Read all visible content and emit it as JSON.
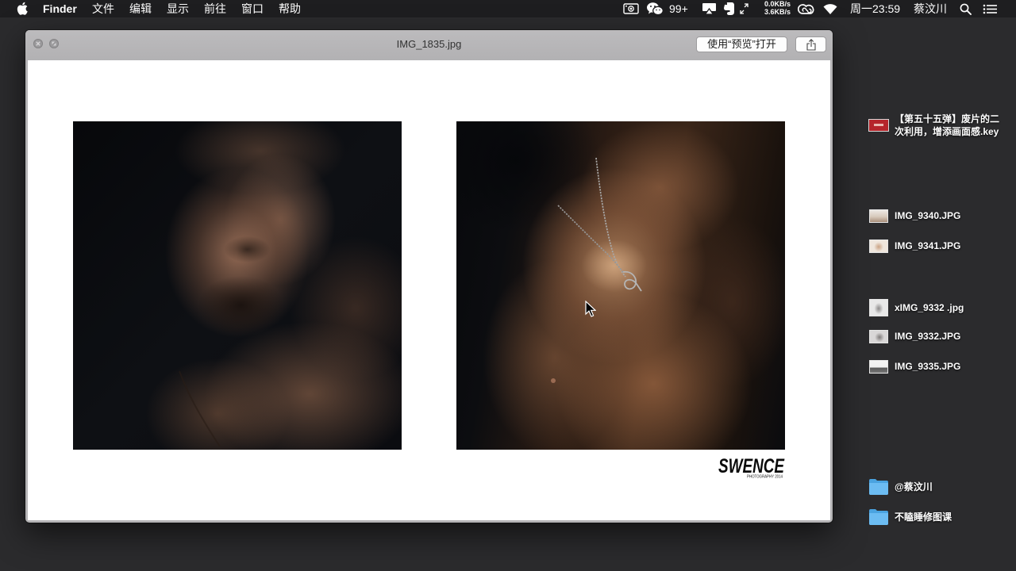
{
  "menubar": {
    "app_name": "Finder",
    "menus": [
      "文件",
      "编辑",
      "显示",
      "前往",
      "窗口",
      "帮助"
    ],
    "status": {
      "wechat_badge": "99+",
      "net_upload": "0.0KB/s",
      "net_download": "3.6KB/s",
      "clock": "周一23:59",
      "user": "蔡汶川"
    },
    "icons": [
      "apple-icon",
      "screen-record-icon",
      "wechat-icon",
      "airplay-icon",
      "evernote-icon",
      "expand-icon",
      "creative-cloud-icon",
      "wifi-icon",
      "search-icon",
      "list-icon"
    ]
  },
  "quicklook": {
    "title": "IMG_1835.jpg",
    "open_with_label": "使用“预览”打开",
    "icons": [
      "close-icon",
      "fullscreen-icon",
      "share-icon"
    ],
    "logo": {
      "text": "SWENCE",
      "subtitle": "PHOTOGRAPHY 2014"
    }
  },
  "desktop": {
    "items": [
      {
        "icon": "keynote-file-icon",
        "lines": [
          "【第五十五弹】废片的二",
          "次利用，增添画面感.key"
        ]
      },
      {
        "icon": "image-file-icon",
        "lines": [
          "IMG_9340.JPG"
        ]
      },
      {
        "icon": "image-file-icon",
        "lines": [
          "IMG_9341.JPG"
        ]
      },
      {
        "icon": "image-file-icon",
        "lines": [
          "xIMG_9332 .jpg"
        ]
      },
      {
        "icon": "image-file-icon",
        "lines": [
          "IMG_9332.JPG"
        ]
      },
      {
        "icon": "image-file-icon",
        "lines": [
          "IMG_9335.JPG"
        ]
      },
      {
        "icon": "folder-icon",
        "lines": [
          "@蔡汶川"
        ]
      },
      {
        "icon": "folder-icon",
        "lines": [
          "不瞌睡修图课"
        ]
      }
    ]
  },
  "colors": {
    "desktop": "#2b2b2d",
    "menubar": "#1e1e20",
    "titlebar": "#b5b4b6",
    "folder": "#5cb3ee",
    "keynote_thumb": "#b5252b"
  },
  "cursor": "arrow-cursor-icon"
}
